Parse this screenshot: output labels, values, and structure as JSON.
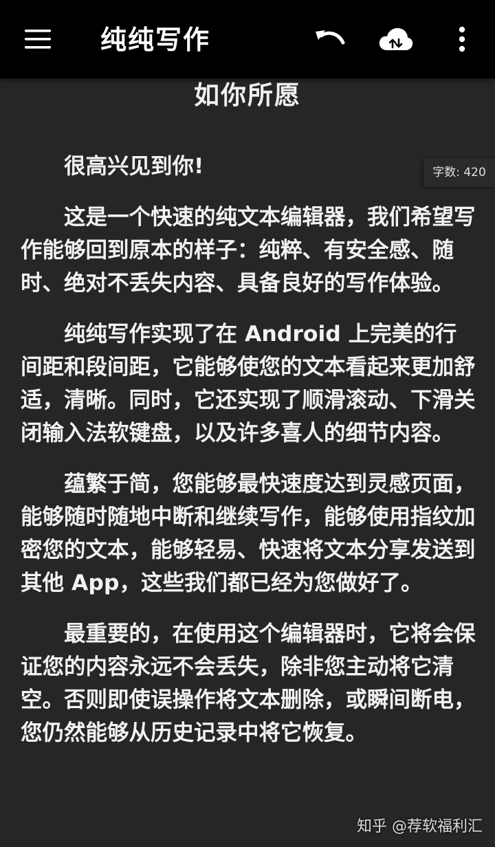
{
  "appbar": {
    "title": "纯纯写作",
    "menu_icon": "menu-icon",
    "undo_icon": "undo-icon",
    "cloud_icon": "cloud-sync-icon",
    "more_icon": "more-vert-icon"
  },
  "document": {
    "title": "如你所愿",
    "word_count": "字数: 420",
    "paragraphs": [
      "很高兴见到你!",
      "这是一个快速的纯文本编辑器，我们希望写作能够回到原本的样子：纯粹、有安全感、随时、绝对不丢失内容、具备良好的写作体验。",
      "纯纯写作实现了在 Android 上完美的行间距和段间距，它能够使您的文本看起来更加舒适，清晰。同时，它还实现了顺滑滚动、下滑关闭输入法软键盘，以及许多喜人的细节内容。",
      "蕴繁于简，您能够最快速度达到灵感页面，能够随时随地中断和继续写作，能够使用指纹加密您的文本，能够轻易、快速将文本分享发送到其他 App，这些我们都已经为您做好了。",
      "最重要的，在使用这个编辑器时，它将会保证您的内容永远不会丢失，除非您主动将它清空。否则即使误操作将文本删除，或瞬间断电，您仍然能够从历史记录中将它恢复。"
    ]
  },
  "watermark": "知乎 @荐软福利汇",
  "colors": {
    "appbar_bg": "#000000",
    "editor_bg": "#262626",
    "text": "#f2f2f2"
  }
}
